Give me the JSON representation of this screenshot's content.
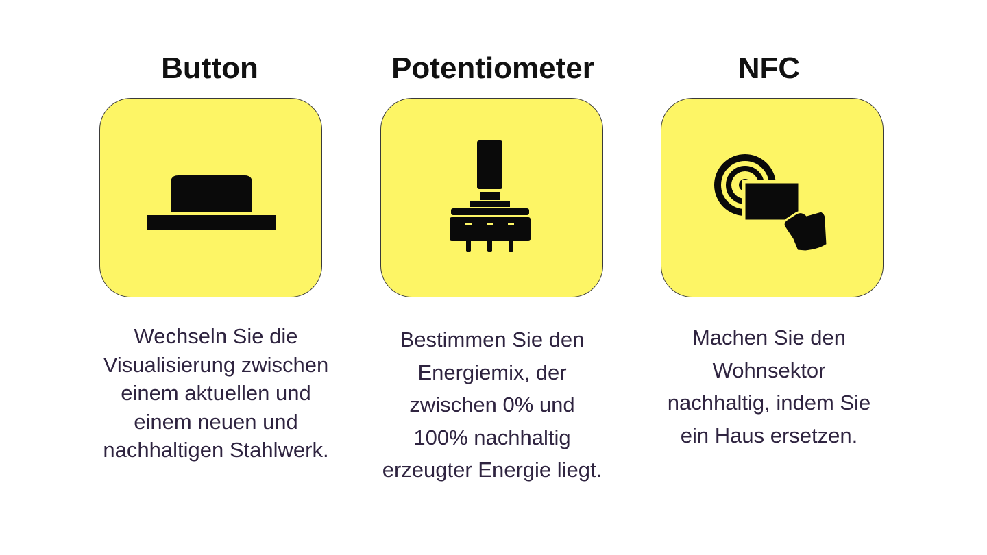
{
  "colors": {
    "tile_fill": "#fdf565",
    "tile_border": "#3a3a3a",
    "icon": "#0a0a0a",
    "title_text": "#111111",
    "description_text": "#2f2440"
  },
  "cards": [
    {
      "title": "Button",
      "icon": "push-button-icon",
      "description": "Wechseln Sie die\nVisualisierung zwischen\neinem aktuellen und\neinem neuen und\nnachhaltigen Stahlwerk."
    },
    {
      "title": "Potentiometer",
      "icon": "potentiometer-icon",
      "description": "Bestimmen Sie den\nEnergiemix, der\nzwischen 0% und\n100% nachhaltig\nerzeugter Energie liegt."
    },
    {
      "title": "NFC",
      "icon": "nfc-card-tap-icon",
      "description": "Machen Sie den\nWohnsektor\nnachhaltig, indem Sie\nein Haus ersetzen."
    }
  ]
}
